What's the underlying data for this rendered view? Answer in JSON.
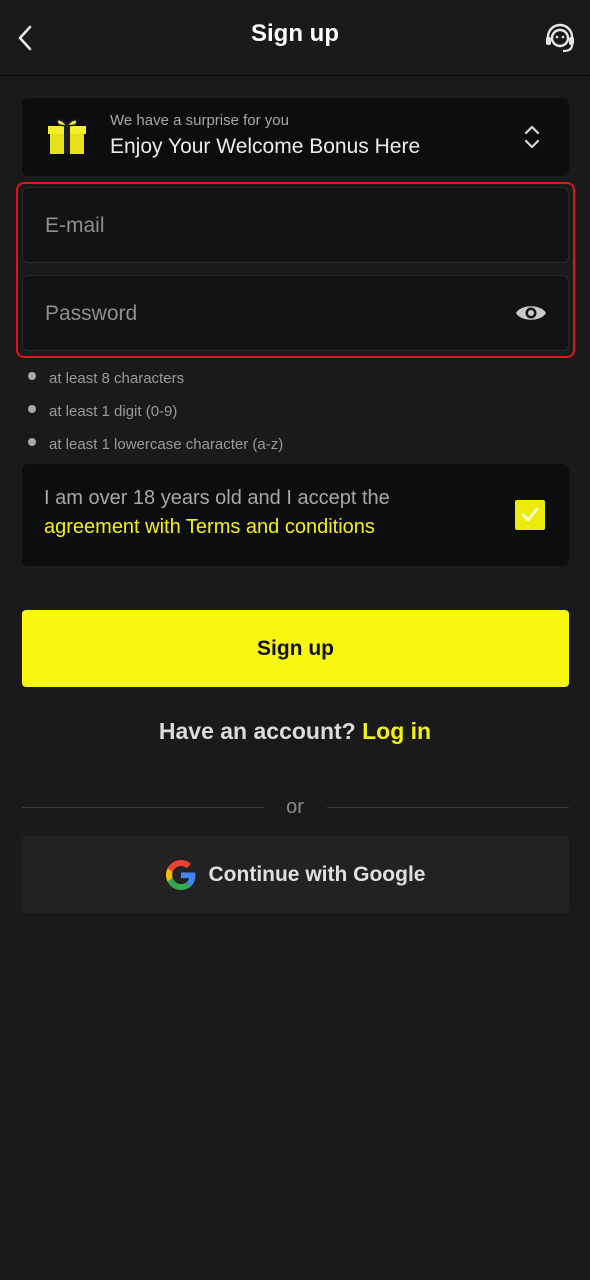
{
  "header": {
    "title": "Sign up",
    "back_icon": "chevron-left-icon",
    "support_icon": "headset-support-icon"
  },
  "bonus": {
    "subtitle": "We have a surprise for you",
    "title": "Enjoy Your Welcome Bonus Here",
    "icon": "gift-icon",
    "toggle_icon": "chevron-up-down-icon"
  },
  "form": {
    "email_placeholder": "E-mail",
    "email_value": "",
    "password_placeholder": "Password",
    "password_value": "",
    "password_toggle_icon": "eye-icon",
    "highlight_color": "#e0141d"
  },
  "password_rules": [
    "at least 8 characters",
    "at least 1 digit (0-9)",
    "at least 1 lowercase character (a-z)"
  ],
  "agreement": {
    "text": "I am over 18 years old and I accept the",
    "link": "agreement with Terms and conditions",
    "checked": true
  },
  "signup_button": "Sign up",
  "login": {
    "prompt": "Have an account?",
    "link": "Log in"
  },
  "divider": "or",
  "google_button": "Continue with Google",
  "colors": {
    "background": "#1a1a1a",
    "accent": "#f7f70f",
    "panel": "#0d0d0d"
  }
}
